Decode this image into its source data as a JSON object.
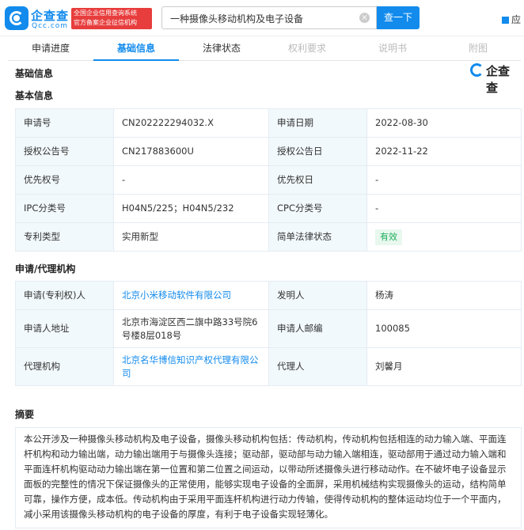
{
  "header": {
    "logo_name": "企查查",
    "logo_domain": "Qcc.com",
    "badge_line1": "全国企业信用查询系统",
    "badge_line2": "官方备案企业征信机构",
    "search_value": "一种摄像头移动机构及电子设备",
    "search_button": "查一下",
    "app_link": "应"
  },
  "tabs": [
    {
      "label": "申请进度",
      "state": "normal"
    },
    {
      "label": "基础信息",
      "state": "active"
    },
    {
      "label": "法律状态",
      "state": "normal"
    },
    {
      "label": "权利要求",
      "state": "disabled"
    },
    {
      "label": "说明书",
      "state": "disabled"
    },
    {
      "label": "附图",
      "state": "disabled"
    }
  ],
  "watermark": "企查查",
  "section_main": "基础信息",
  "basic": {
    "title": "基本信息",
    "rows": [
      {
        "k1": "申请号",
        "v1": "CN202222294032.X",
        "k2": "申请日期",
        "v2": "2022-08-30"
      },
      {
        "k1": "授权公告号",
        "v1": "CN217883600U",
        "k2": "授权公告日",
        "v2": "2022-11-22"
      },
      {
        "k1": "优先权号",
        "v1": "-",
        "k2": "优先权日",
        "v2": "-"
      },
      {
        "k1": "IPC分类号",
        "v1": "H04N5/225；H04N5/232",
        "k2": "CPC分类号",
        "v2": "-"
      },
      {
        "k1": "专利类型",
        "v1": "实用新型",
        "k2": "简单法律状态",
        "v2": "有效"
      }
    ]
  },
  "agency": {
    "title": "申请/代理机构",
    "rows": [
      {
        "k1": "申请(专利权)人",
        "v1": "北京小米移动软件有限公司",
        "k2": "发明人",
        "v2": "杨涛"
      },
      {
        "k1": "申请人地址",
        "v1": "北京市海淀区西二旗中路33号院6号楼8层018号",
        "k2": "申请人邮编",
        "v2": "100085"
      },
      {
        "k1": "代理机构",
        "v1": "北京名华博信知识产权代理有限公司",
        "k2": "代理人",
        "v2": "刘馨月"
      }
    ]
  },
  "abstract": {
    "title": "摘要",
    "text": "本公开涉及一种摄像头移动机构及电子设备，摄像头移动机构包括：传动机构，传动机构包括相连的动力输入端、平面连杆机构和动力输出端，动力输出端用于与摄像头连接；驱动部，驱动部与动力输入端相连，驱动部用于通过动力输入端和平面连杆机构驱动动力输出端在第一位置和第二位置之间运动，以带动所述摄像头进行移动动作。在不破坏电子设备显示面板的完整性的情况下保证摄像头的正常使用，能够实现电子设备的全面屏，采用机械结构实现摄像头的运动，结构简单可靠，操作方便，成本低。传动机构由于采用平面连杆机构进行动力传输，使得传动机构的整体运动均位于一个平面内，减小采用该摄像头移动机构的电子设备的厚度，有利于电子设备实现轻薄化。"
  }
}
